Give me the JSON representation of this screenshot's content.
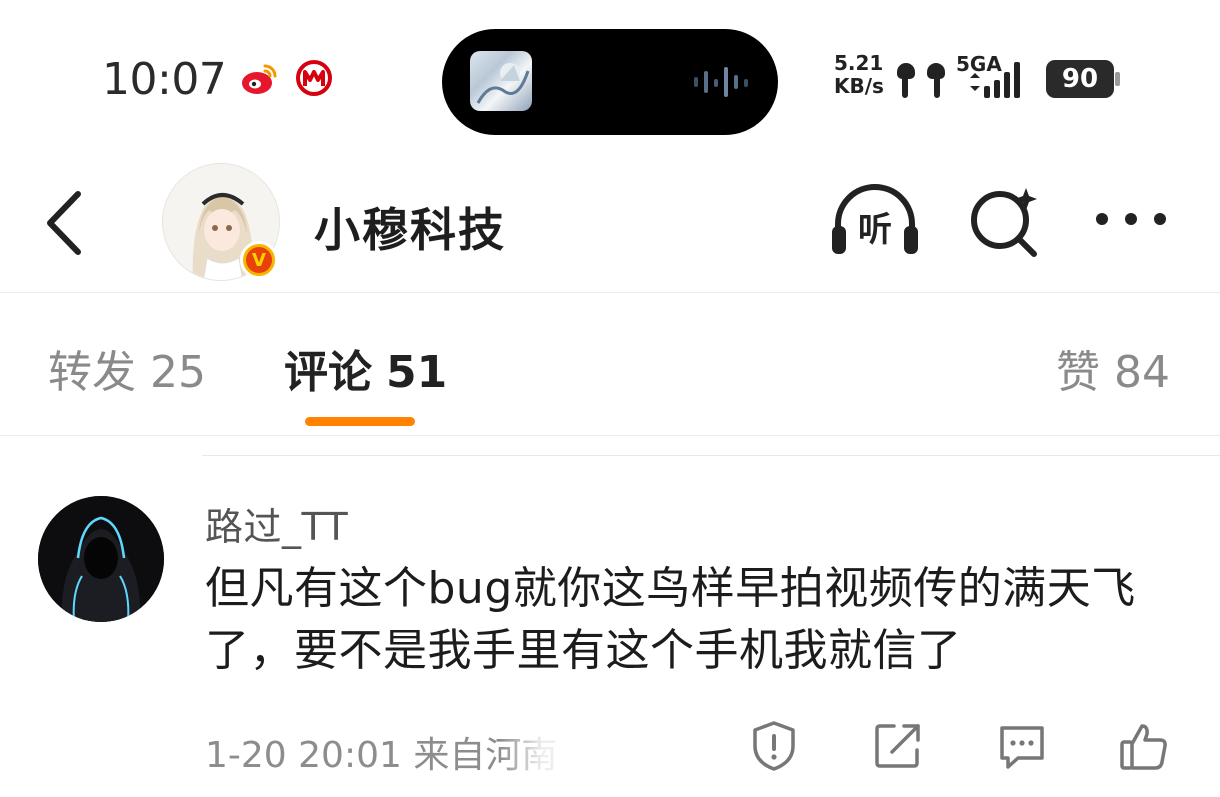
{
  "status_bar": {
    "time": "10:07",
    "net_speed_value": "5.21",
    "net_speed_unit": "KB/s",
    "net_type": "5GA",
    "battery": "90",
    "icons": [
      "weibo-icon",
      "bank-icon",
      "earbuds-icon",
      "signal-icon",
      "battery-icon"
    ]
  },
  "header": {
    "account_name": "小穆科技",
    "verified_badge": "V",
    "listen_label": "听",
    "icons": [
      "back-arrow-icon",
      "headphones-icon",
      "search-sparkle-icon",
      "more-dots-icon"
    ]
  },
  "tabs": {
    "repost_label": "转发",
    "repost_count": "25",
    "comments_label": "评论",
    "comments_count": "51",
    "likes_label": "赞",
    "likes_count": "84",
    "active_tab": "comments",
    "accent_color": "#ff8200"
  },
  "comment": {
    "user": "路过_TT",
    "text": "但凡有这个bug就你这鸟样早拍视频传的满天飞了，要不是我手里有这个手机我就信了",
    "meta": "1-20 20:01 来自河南",
    "actions": [
      "report-icon",
      "share-icon",
      "reply-icon",
      "like-icon"
    ]
  }
}
